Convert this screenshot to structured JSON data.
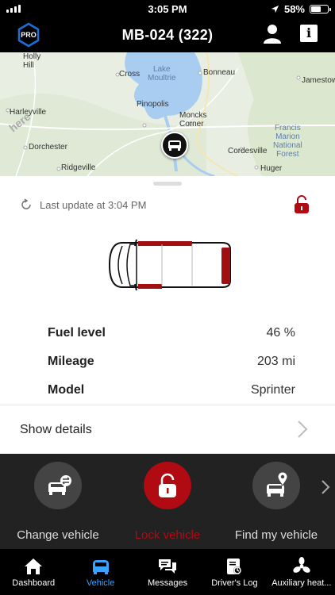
{
  "status_bar": {
    "time": "3:05 PM",
    "battery": "58%",
    "battery_level": 0.58
  },
  "header": {
    "title": "MB-024 (322)",
    "logo_text": "PRO",
    "info_icon_text": "i"
  },
  "map": {
    "watermark": "here",
    "labels": {
      "holly_hill": "Holly\nHill",
      "cross": "Cross",
      "lake": "Lake\nMoultrie",
      "bonneau": "Bonneau",
      "jamestown": "Jamestown",
      "pinopolis": "Pinopolis",
      "harleyville": "Harleyville",
      "moncks": "Moncks\nCorner",
      "francis": "Francis\nMarion\nNational\nForest",
      "dorchester": "Dorchester",
      "cordesville": "Cordesville",
      "ridgeville": "Ridgeville",
      "huger": "Huger"
    }
  },
  "vehicle": {
    "last_update": "Last update at 3:04 PM",
    "specs": [
      {
        "key": "Fuel level",
        "value": "46 %"
      },
      {
        "key": "Mileage",
        "value": "203 mi"
      },
      {
        "key": "Model",
        "value": "Sprinter"
      }
    ],
    "show_details": "Show details"
  },
  "actions": [
    {
      "label": "Change vehicle",
      "icon": "change-vehicle-icon"
    },
    {
      "label": "Lock vehicle",
      "icon": "lock-icon"
    },
    {
      "label": "Find my vehicle",
      "icon": "find-vehicle-icon"
    }
  ],
  "tabs": [
    {
      "label": "Dashboard",
      "icon": "home-icon",
      "active": false
    },
    {
      "label": "Vehicle",
      "icon": "vehicle-icon",
      "active": true
    },
    {
      "label": "Messages",
      "icon": "messages-icon",
      "active": false
    },
    {
      "label": "Driver's Log",
      "icon": "drivers-log-icon",
      "active": false
    },
    {
      "label": "Auxiliary heat...",
      "icon": "fan-icon",
      "active": false
    }
  ],
  "colors": {
    "accent": "#b00a12",
    "active_tab": "#3aa3ff",
    "action_bar": "#222222"
  }
}
